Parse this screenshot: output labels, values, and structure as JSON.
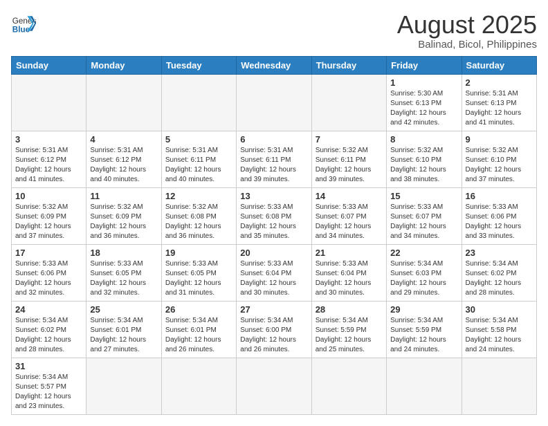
{
  "header": {
    "logo_general": "General",
    "logo_blue": "Blue",
    "month_title": "August 2025",
    "location": "Balinad, Bicol, Philippines"
  },
  "weekdays": [
    "Sunday",
    "Monday",
    "Tuesday",
    "Wednesday",
    "Thursday",
    "Friday",
    "Saturday"
  ],
  "weeks": [
    [
      {
        "day": "",
        "info": ""
      },
      {
        "day": "",
        "info": ""
      },
      {
        "day": "",
        "info": ""
      },
      {
        "day": "",
        "info": ""
      },
      {
        "day": "",
        "info": ""
      },
      {
        "day": "1",
        "info": "Sunrise: 5:30 AM\nSunset: 6:13 PM\nDaylight: 12 hours\nand 42 minutes."
      },
      {
        "day": "2",
        "info": "Sunrise: 5:31 AM\nSunset: 6:13 PM\nDaylight: 12 hours\nand 41 minutes."
      }
    ],
    [
      {
        "day": "3",
        "info": "Sunrise: 5:31 AM\nSunset: 6:12 PM\nDaylight: 12 hours\nand 41 minutes."
      },
      {
        "day": "4",
        "info": "Sunrise: 5:31 AM\nSunset: 6:12 PM\nDaylight: 12 hours\nand 40 minutes."
      },
      {
        "day": "5",
        "info": "Sunrise: 5:31 AM\nSunset: 6:11 PM\nDaylight: 12 hours\nand 40 minutes."
      },
      {
        "day": "6",
        "info": "Sunrise: 5:31 AM\nSunset: 6:11 PM\nDaylight: 12 hours\nand 39 minutes."
      },
      {
        "day": "7",
        "info": "Sunrise: 5:32 AM\nSunset: 6:11 PM\nDaylight: 12 hours\nand 39 minutes."
      },
      {
        "day": "8",
        "info": "Sunrise: 5:32 AM\nSunset: 6:10 PM\nDaylight: 12 hours\nand 38 minutes."
      },
      {
        "day": "9",
        "info": "Sunrise: 5:32 AM\nSunset: 6:10 PM\nDaylight: 12 hours\nand 37 minutes."
      }
    ],
    [
      {
        "day": "10",
        "info": "Sunrise: 5:32 AM\nSunset: 6:09 PM\nDaylight: 12 hours\nand 37 minutes."
      },
      {
        "day": "11",
        "info": "Sunrise: 5:32 AM\nSunset: 6:09 PM\nDaylight: 12 hours\nand 36 minutes."
      },
      {
        "day": "12",
        "info": "Sunrise: 5:32 AM\nSunset: 6:08 PM\nDaylight: 12 hours\nand 36 minutes."
      },
      {
        "day": "13",
        "info": "Sunrise: 5:33 AM\nSunset: 6:08 PM\nDaylight: 12 hours\nand 35 minutes."
      },
      {
        "day": "14",
        "info": "Sunrise: 5:33 AM\nSunset: 6:07 PM\nDaylight: 12 hours\nand 34 minutes."
      },
      {
        "day": "15",
        "info": "Sunrise: 5:33 AM\nSunset: 6:07 PM\nDaylight: 12 hours\nand 34 minutes."
      },
      {
        "day": "16",
        "info": "Sunrise: 5:33 AM\nSunset: 6:06 PM\nDaylight: 12 hours\nand 33 minutes."
      }
    ],
    [
      {
        "day": "17",
        "info": "Sunrise: 5:33 AM\nSunset: 6:06 PM\nDaylight: 12 hours\nand 32 minutes."
      },
      {
        "day": "18",
        "info": "Sunrise: 5:33 AM\nSunset: 6:05 PM\nDaylight: 12 hours\nand 32 minutes."
      },
      {
        "day": "19",
        "info": "Sunrise: 5:33 AM\nSunset: 6:05 PM\nDaylight: 12 hours\nand 31 minutes."
      },
      {
        "day": "20",
        "info": "Sunrise: 5:33 AM\nSunset: 6:04 PM\nDaylight: 12 hours\nand 30 minutes."
      },
      {
        "day": "21",
        "info": "Sunrise: 5:33 AM\nSunset: 6:04 PM\nDaylight: 12 hours\nand 30 minutes."
      },
      {
        "day": "22",
        "info": "Sunrise: 5:34 AM\nSunset: 6:03 PM\nDaylight: 12 hours\nand 29 minutes."
      },
      {
        "day": "23",
        "info": "Sunrise: 5:34 AM\nSunset: 6:02 PM\nDaylight: 12 hours\nand 28 minutes."
      }
    ],
    [
      {
        "day": "24",
        "info": "Sunrise: 5:34 AM\nSunset: 6:02 PM\nDaylight: 12 hours\nand 28 minutes."
      },
      {
        "day": "25",
        "info": "Sunrise: 5:34 AM\nSunset: 6:01 PM\nDaylight: 12 hours\nand 27 minutes."
      },
      {
        "day": "26",
        "info": "Sunrise: 5:34 AM\nSunset: 6:01 PM\nDaylight: 12 hours\nand 26 minutes."
      },
      {
        "day": "27",
        "info": "Sunrise: 5:34 AM\nSunset: 6:00 PM\nDaylight: 12 hours\nand 26 minutes."
      },
      {
        "day": "28",
        "info": "Sunrise: 5:34 AM\nSunset: 5:59 PM\nDaylight: 12 hours\nand 25 minutes."
      },
      {
        "day": "29",
        "info": "Sunrise: 5:34 AM\nSunset: 5:59 PM\nDaylight: 12 hours\nand 24 minutes."
      },
      {
        "day": "30",
        "info": "Sunrise: 5:34 AM\nSunset: 5:58 PM\nDaylight: 12 hours\nand 24 minutes."
      }
    ],
    [
      {
        "day": "31",
        "info": "Sunrise: 5:34 AM\nSunset: 5:57 PM\nDaylight: 12 hours\nand 23 minutes."
      },
      {
        "day": "",
        "info": ""
      },
      {
        "day": "",
        "info": ""
      },
      {
        "day": "",
        "info": ""
      },
      {
        "day": "",
        "info": ""
      },
      {
        "day": "",
        "info": ""
      },
      {
        "day": "",
        "info": ""
      }
    ]
  ]
}
